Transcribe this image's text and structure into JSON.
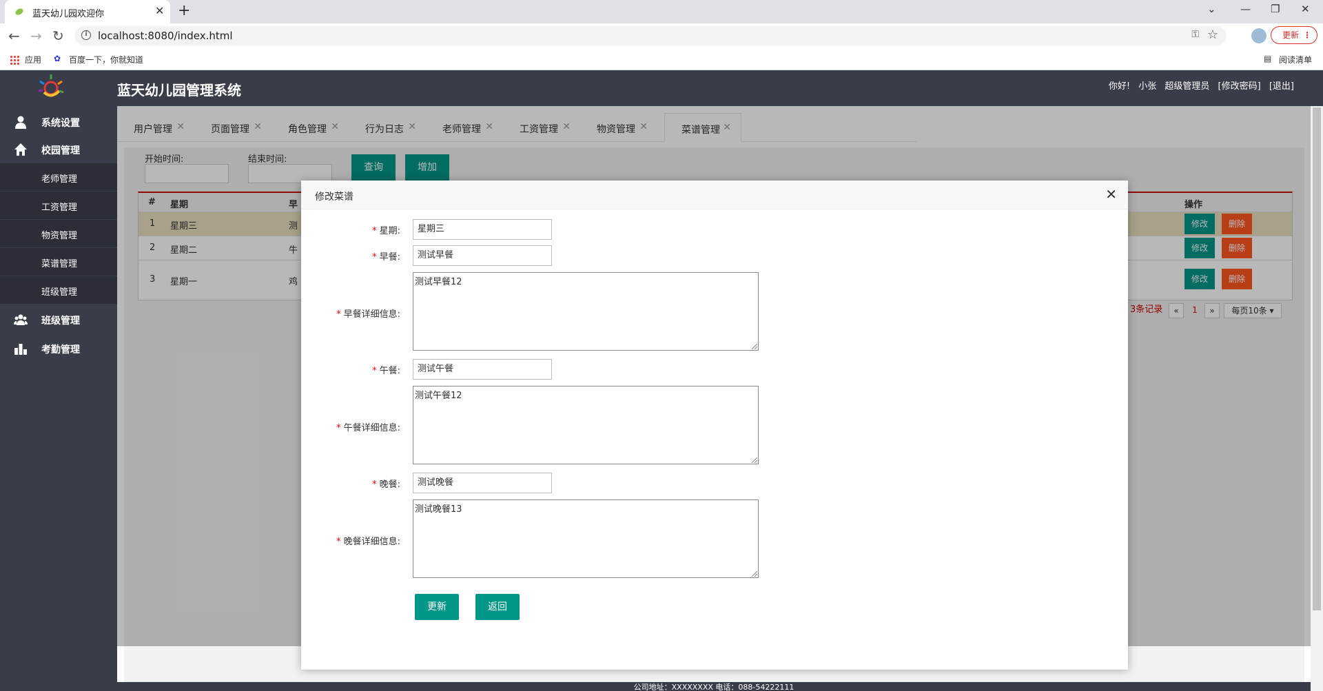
{
  "browser": {
    "tab_title": "蓝天幼儿园欢迎你",
    "url": "localhost:8080/index.html",
    "update_label": "更新",
    "bookmarks": [
      "应用",
      "百度一下，你就知道"
    ],
    "reading_list": "阅读清单"
  },
  "app": {
    "title": "蓝天幼儿园管理系统",
    "user": {
      "greeting": "你好!",
      "name": "小张",
      "role": "超级管理员",
      "change_password": "[修改密码]",
      "logout": "[退出]"
    },
    "sidebar": {
      "items": [
        {
          "label": "系统设置",
          "icon": "user-icon"
        },
        {
          "label": "校园管理",
          "icon": "home-icon"
        },
        {
          "label": "班级管理",
          "icon": "group-icon"
        },
        {
          "label": "考勤管理",
          "icon": "bar-chart-icon"
        }
      ],
      "sub_items": [
        "老师管理",
        "工资管理",
        "物资管理",
        "菜谱管理",
        "班级管理"
      ]
    },
    "tabs": [
      "用户管理",
      "页面管理",
      "角色管理",
      "行为日志",
      "老师管理",
      "工资管理",
      "物资管理",
      "菜谱管理"
    ],
    "active_tab": "菜谱管理",
    "search": {
      "start_label": "开始时间:",
      "end_label": "结束时间:",
      "query_button": "查询",
      "add_button": "增加"
    },
    "table": {
      "headers": {
        "index": "#",
        "weekday": "星期",
        "breakfast": "早",
        "actions": "操作"
      },
      "rows": [
        {
          "index": "1",
          "weekday": "星期三",
          "breakfast": "测"
        },
        {
          "index": "2",
          "weekday": "星期二",
          "breakfast": "牛"
        },
        {
          "index": "3",
          "weekday": "星期一",
          "breakfast": "鸡"
        }
      ],
      "edit_label": "修改",
      "delete_label": "删除"
    },
    "pagination": {
      "records": "3条记录",
      "prev": "«",
      "page": "1",
      "next": "»",
      "page_size": "每页10条"
    },
    "footer": "公司地址：XXXXXXXX 电话：088-54222111"
  },
  "modal": {
    "title": "修改菜谱",
    "fields": {
      "weekday": {
        "label": "星期:",
        "value": "星期三"
      },
      "breakfast": {
        "label": "早餐:",
        "value": "测试早餐"
      },
      "breakfast_detail": {
        "label": "早餐详细信息:",
        "value": "测试早餐12"
      },
      "lunch": {
        "label": "午餐:",
        "value": "测试午餐"
      },
      "lunch_detail": {
        "label": "午餐详细信息:",
        "value": "测试午餐12"
      },
      "dinner": {
        "label": "晚餐:",
        "value": "测试晚餐"
      },
      "dinner_detail": {
        "label": "晚餐详细信息:",
        "value": "测试晚餐13"
      }
    },
    "required_mark": "*",
    "update_button": "更新",
    "back_button": "返回"
  },
  "colors": {
    "header_bg": "#393d49",
    "accent": "#009688",
    "danger": "#ff5722",
    "highlight_row": "#e8dfbf"
  }
}
